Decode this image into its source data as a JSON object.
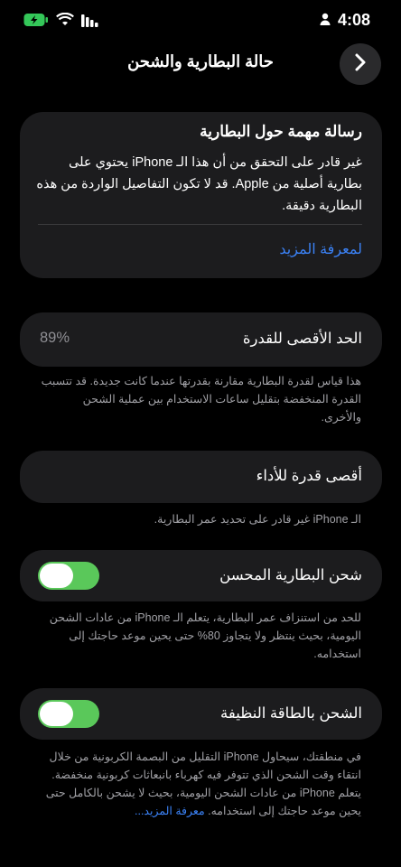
{
  "status_bar": {
    "time": "4:08"
  },
  "nav": {
    "title": "حالة البطارية والشحن"
  },
  "message": {
    "title": "رسالة مهمة حول البطارية",
    "body": "غير قادر على التحقق من أن هذا الـ iPhone يحتوي على بطارية أصلية من Apple. قد لا تكون التفاصيل الواردة من هذه البطارية دقيقة.",
    "link": "لمعرفة المزيد"
  },
  "max_capacity": {
    "label": "الحد الأقصى للقدرة",
    "value": "89%",
    "footer": "هذا قياس لقدرة البطارية مقارنة بقدرتها عندما كانت جديدة. قد تتسبب القدرة المنخفضة بتقليل ساعات الاستخدام بين عملية الشحن والأخرى."
  },
  "peak_performance": {
    "label": "أقصى قدرة للأداء",
    "footer": "الـ iPhone غير قادر على تحديد عمر البطارية."
  },
  "optimized_charging": {
    "label": "شحن البطارية المحسن",
    "enabled": true,
    "footer": "للحد من استنزاف عمر البطارية، يتعلم الـ iPhone من عادات الشحن اليومية، بحيث ينتظر ولا يتجاوز 80% حتى يحين موعد حاجتك إلى استخدامه."
  },
  "clean_energy": {
    "label": "الشحن بالطاقة النظيفة",
    "enabled": true,
    "footer": "في منطقتك، سيحاول iPhone التقليل من البصمة الكربونية من خلال انتقاء وقت الشحن الذي تتوفر فيه كهرباء بانبعاثات كربونية منخفضة. يتعلم iPhone من عادات الشحن اليومية، بحيث لا يشحن بالكامل حتى يحين موعد حاجتك إلى استخدامه.",
    "footer_link": "معرفة المزيد..."
  },
  "colors": {
    "accent": "#3b82f6",
    "toggle_on": "#5ac85a",
    "card": "#1c1c1e"
  }
}
